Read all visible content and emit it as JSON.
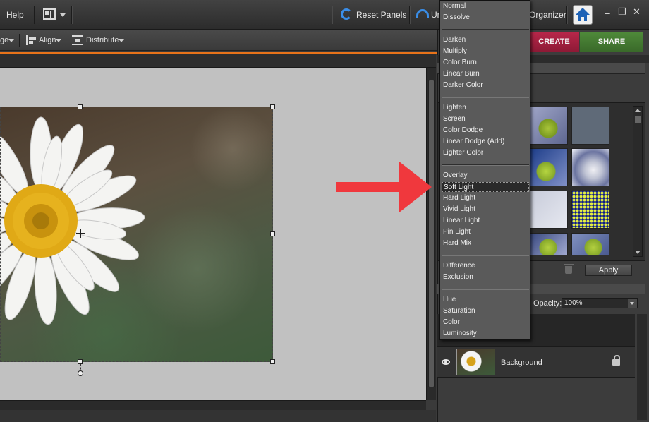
{
  "menubar": {
    "help_label": "Help",
    "reset_panels_label": "Reset Panels",
    "undo_label": "Un",
    "organizer_label": "Organizer",
    "minimize": "_",
    "restore": "❐",
    "close": "✕"
  },
  "options_bar": {
    "arrange_label": "ge",
    "align_label": "Align",
    "distribute_label": "Distribute"
  },
  "mode_buttons": {
    "create_label": "CREATE",
    "share_label": "SHARE"
  },
  "effects_panel": {
    "apply_label": "Apply"
  },
  "layers_panel": {
    "opacity_label": "Opacity:",
    "opacity_value": "100%",
    "layer_name": "Background"
  },
  "blend_menu": {
    "selected": "Soft Light",
    "groups": [
      [
        "Normal",
        "Dissolve"
      ],
      [
        "Darken",
        "Multiply",
        "Color Burn",
        "Linear Burn",
        "Darker Color"
      ],
      [
        "Lighten",
        "Screen",
        "Color Dodge",
        "Linear Dodge (Add)",
        "Lighter Color"
      ],
      [
        "Overlay",
        "Soft Light",
        "Hard Light",
        "Vivid Light",
        "Linear Light",
        "Pin Light",
        "Hard Mix"
      ],
      [
        "Difference",
        "Exclusion"
      ],
      [
        "Hue",
        "Saturation",
        "Color",
        "Luminosity"
      ]
    ]
  },
  "colors": {
    "accent_orange": "#e8731a",
    "create_red": "#a5213f",
    "share_green": "#4a7f35",
    "arrow_red": "#f0383d"
  }
}
